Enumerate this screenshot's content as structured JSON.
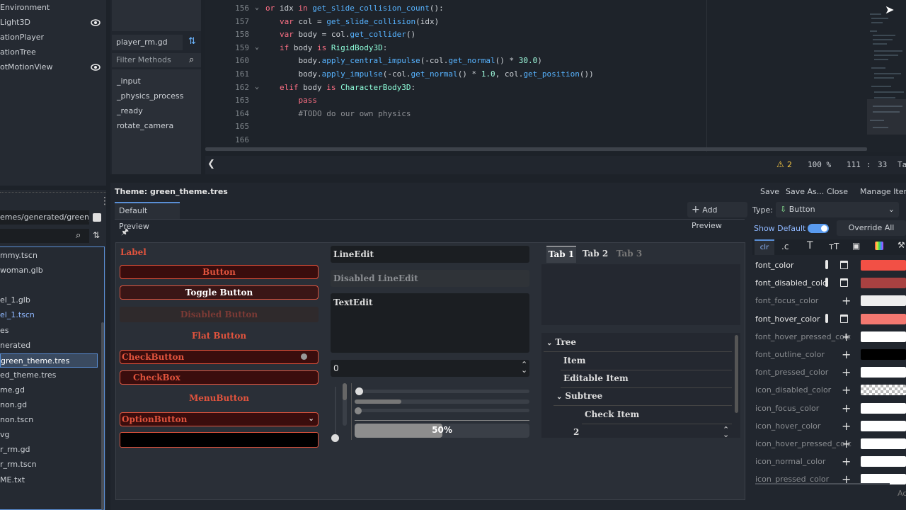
{
  "scene_tree": [
    {
      "label": "Environment",
      "eye": false
    },
    {
      "label": "Light3D",
      "eye": true
    },
    {
      "label": "ationPlayer",
      "eye": false
    },
    {
      "label": "ationTree",
      "eye": false
    },
    {
      "label": "otMotionView",
      "eye": true
    }
  ],
  "script_panel": {
    "current_script": "player_rm.gd",
    "filter_placeholder": "Filter Methods",
    "methods": [
      "_input",
      "_physics_process",
      "_ready",
      "rotate_camera"
    ]
  },
  "code": {
    "lines": [
      {
        "n": "156",
        "html": "<span class='kw'>or</span> idx <span class='kw'>in</span> <span class='fn'>get_slide_collision_count</span>():"
      },
      {
        "n": "157",
        "html": "  <span class='kw'>var</span> col = <span class='fn'>get_slide_collision</span>(idx)"
      },
      {
        "n": "158",
        "html": "  <span class='kw'>var</span> body = col.<span class='fn'>get_collider</span>()"
      },
      {
        "n": "159",
        "html": "  <span class='kw'>if</span> body <span class='kw'>is</span> <span class='cls'>RigidBody3D</span>:"
      },
      {
        "n": "160",
        "html": "      body.<span class='fn'>apply_central_impulse</span>(-col.<span class='fn'>get_normal</span>() * <span class='num'>30.0</span>)"
      },
      {
        "n": "161",
        "html": "      body.<span class='fn'>apply_impulse</span>(-col.<span class='fn'>get_normal</span>() * <span class='num'>1.0</span>, col.<span class='fn'>get_position</span>())"
      },
      {
        "n": "162",
        "html": "  <span class='kw'>elif</span> body <span class='kw'>is</span> <span class='cls'>CharacterBody3D</span>:"
      },
      {
        "n": "163",
        "html": "      <span class='kw'>pass</span>"
      },
      {
        "n": "164",
        "html": "      <span class='cm'>#TODO do our own physics</span>"
      },
      {
        "n": "165",
        "html": ""
      },
      {
        "n": "166",
        "html": ""
      }
    ]
  },
  "status": {
    "warnings": "2",
    "zoom": "100 %",
    "line": "111",
    "col": "33",
    "tab_label": "Ta"
  },
  "filesystem": {
    "path": "emes/generated/green_t",
    "files": [
      {
        "label": "mmy.tscn",
        "color": "#cdd1d6"
      },
      {
        "label": "woman.glb",
        "color": "#cdd1d6"
      },
      {
        "label": "",
        "color": "#cdd1d6"
      },
      {
        "label": "el_1.glb",
        "color": "#cdd1d6"
      },
      {
        "label": "el_1.tscn",
        "color": "#8fb8ff"
      },
      {
        "label": "es",
        "color": "#cdd1d6"
      },
      {
        "label": "nerated",
        "color": "#cdd1d6"
      },
      {
        "label": "green_theme.tres",
        "color": "#ffffff"
      },
      {
        "label": "ed_theme.tres",
        "color": "#cdd1d6"
      },
      {
        "label": "me.gd",
        "color": "#cdd1d6"
      },
      {
        "label": "non.gd",
        "color": "#cdd1d6"
      },
      {
        "label": "non.tscn",
        "color": "#cdd1d6"
      },
      {
        "label": "vg",
        "color": "#cdd1d6"
      },
      {
        "label": "r_rm.gd",
        "color": "#cdd1d6"
      },
      {
        "label": "r_rm.tscn",
        "color": "#cdd1d6"
      },
      {
        "label": "ME.txt",
        "color": "#cdd1d6"
      }
    ]
  },
  "theme": {
    "title": "Theme: green_theme.tres",
    "actions": [
      "Save",
      "Save As...",
      "Close",
      "Manage Items"
    ],
    "preview_tab": "Default Preview",
    "add_preview": "Add Preview",
    "type_label": "Type:",
    "type_value": "Button",
    "show_default": "Show Default",
    "override_all": "Override All",
    "tab_icons": [
      "clr",
      ".c",
      "T",
      "TT",
      "img",
      "pal",
      "sty"
    ]
  },
  "preview": {
    "label": "Label",
    "button": "Button",
    "toggle_button": "Toggle Button",
    "disabled_button": "Disabled Button",
    "flat_button": "Flat Button",
    "check_button": "CheckButton",
    "check_box": "CheckBox",
    "menu_button": "MenuButton",
    "option_button": "OptionButton",
    "line_edit": "LineEdit",
    "disabled_line_edit": "Disabled LineEdit",
    "text_edit": "TextEdit",
    "spin_value": "0",
    "progress_text": "50%",
    "progress_value": 0.5,
    "tabs": [
      "Tab 1",
      "Tab 2",
      "Tab 3"
    ],
    "tree": [
      "Tree",
      "Item",
      "Editable Item",
      "Subtree",
      "Check Item",
      "2"
    ]
  },
  "colors": [
    {
      "name": "font_color",
      "overridden": true,
      "color": "#f25045"
    },
    {
      "name": "font_disabled_colc",
      "overridden": true,
      "color": "#a84141"
    },
    {
      "name": "font_focus_color",
      "overridden": false,
      "color": "#eeeeee"
    },
    {
      "name": "font_hover_color",
      "overridden": true,
      "color": "#f37870"
    },
    {
      "name": "font_hover_pressed_colc",
      "overridden": false,
      "color": "#ffffff"
    },
    {
      "name": "font_outline_color",
      "overridden": false,
      "color": "#000000"
    },
    {
      "name": "font_pressed_color",
      "overridden": false,
      "color": "#ffffff"
    },
    {
      "name": "icon_disabled_color",
      "overridden": false,
      "color": "checker"
    },
    {
      "name": "icon_focus_color",
      "overridden": false,
      "color": "#ffffff"
    },
    {
      "name": "icon_hover_color",
      "overridden": false,
      "color": "#ffffff"
    },
    {
      "name": "icon_hover_pressed_colc",
      "overridden": false,
      "color": "#ffffff"
    },
    {
      "name": "icon_normal_color",
      "overridden": false,
      "color": "#ffffff"
    },
    {
      "name": "icon_pressed_color",
      "overridden": false,
      "color": "#ffffff"
    }
  ],
  "bottom_right_hint": "Ac"
}
